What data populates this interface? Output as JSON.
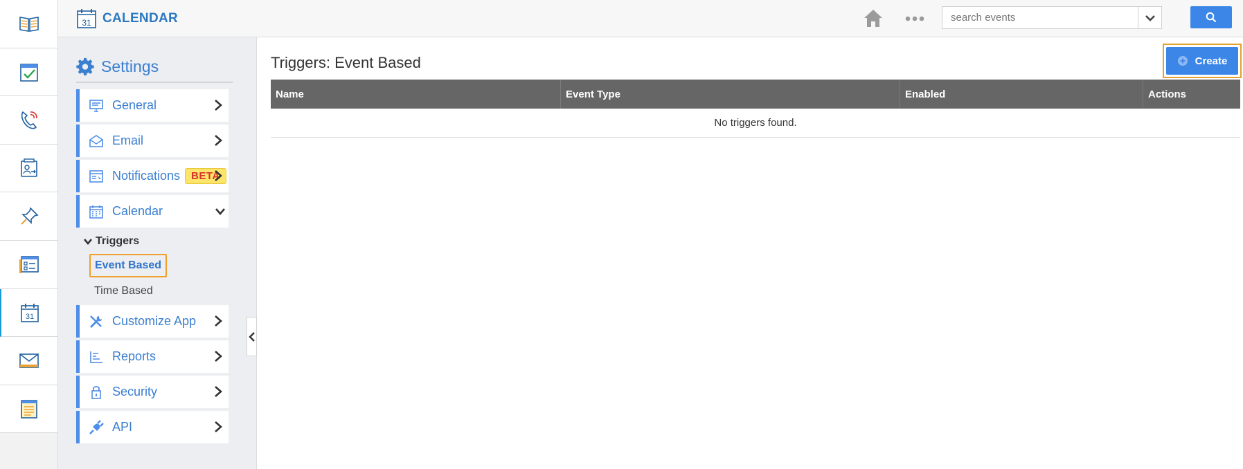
{
  "header": {
    "app_title": "CALENDAR",
    "search_placeholder": "search events"
  },
  "rail": {
    "items": [
      {
        "name": "book-app"
      },
      {
        "name": "tasks-app"
      },
      {
        "name": "calls-app"
      },
      {
        "name": "contacts-app"
      },
      {
        "name": "pin-app"
      },
      {
        "name": "forms-app"
      },
      {
        "name": "calendar-app",
        "active": true
      },
      {
        "name": "mail-app"
      },
      {
        "name": "notes-app"
      }
    ]
  },
  "sidebar": {
    "title": "Settings",
    "items": [
      {
        "label": "General",
        "icon": "monitor-icon"
      },
      {
        "label": "Email",
        "icon": "envelope-icon"
      },
      {
        "label": "Notifications",
        "icon": "notification-icon",
        "badge": "BETA"
      },
      {
        "label": "Calendar",
        "icon": "calendar-icon",
        "expanded": true
      },
      {
        "label": "Customize App",
        "icon": "tools-icon"
      },
      {
        "label": "Reports",
        "icon": "reports-icon"
      },
      {
        "label": "Security",
        "icon": "lock-icon"
      },
      {
        "label": "API",
        "icon": "plug-icon"
      }
    ],
    "sub": {
      "group": "Triggers",
      "selected": "Event Based",
      "other": "Time Based"
    }
  },
  "main": {
    "title": "Triggers: Event Based",
    "create_label": "Create",
    "table": {
      "columns": [
        "Name",
        "Event Type",
        "Enabled",
        "Actions"
      ],
      "empty_text": "No triggers found."
    }
  },
  "colors": {
    "accent": "#3b86e6",
    "brand": "#2b78c2",
    "highlight": "#e3a12d",
    "table_header": "#666666",
    "badge": "#fde56b"
  }
}
